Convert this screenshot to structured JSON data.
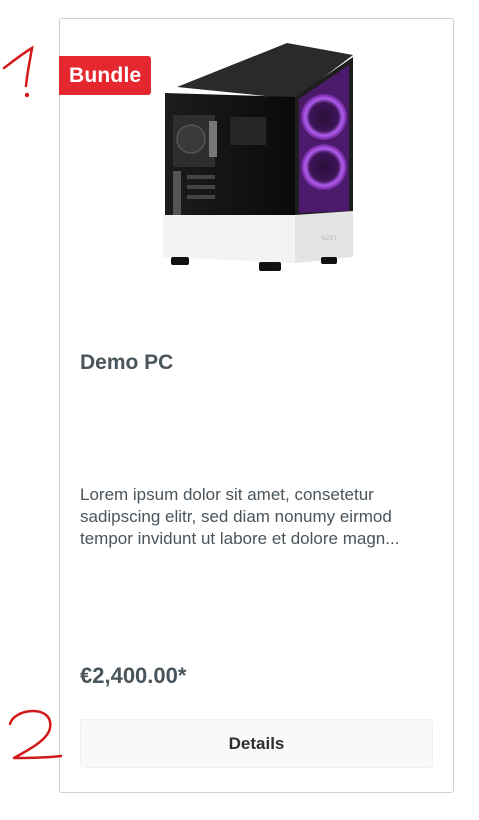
{
  "product": {
    "badge": "Bundle",
    "name": "Demo PC",
    "description": "Lorem ipsum dolor sit amet, consetetur sadipscing elitr, sed diam nonumy eirmod tempor invidunt ut labore et dolore magn...",
    "price": "€2,400.00*",
    "details_label": "Details",
    "image": "pc-case-image",
    "case_label": "NZXT"
  },
  "annotations": [
    "1",
    "2"
  ],
  "colors": {
    "badge": "#e52730",
    "text": "#4a545b",
    "button_bg": "#f9f9f9",
    "annotation": "#d31a1a"
  }
}
